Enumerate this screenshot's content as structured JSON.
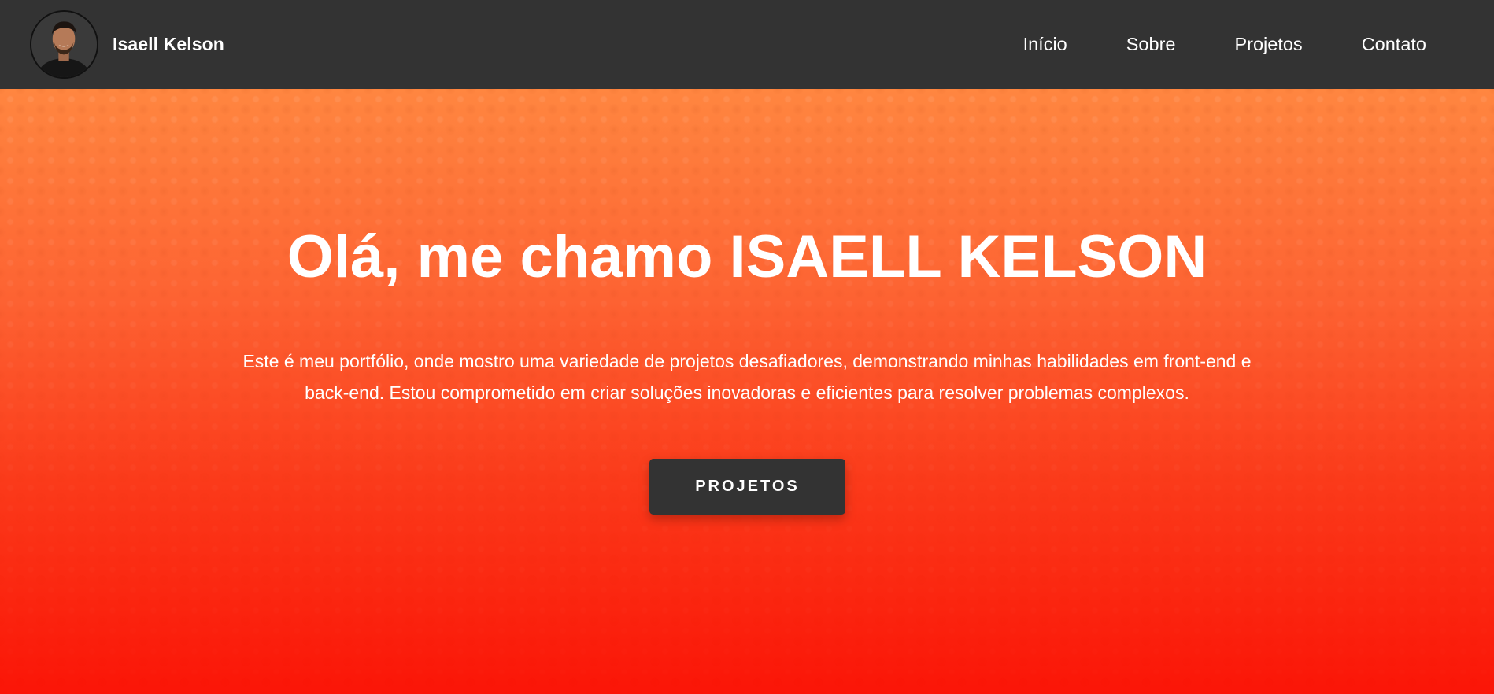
{
  "header": {
    "brand_name": "Isaell Kelson",
    "nav_items": [
      {
        "label": "Início"
      },
      {
        "label": "Sobre"
      },
      {
        "label": "Projetos"
      },
      {
        "label": "Contato"
      }
    ]
  },
  "hero": {
    "title": "Olá, me chamo ISAELL KELSON",
    "description": "Este é meu portfólio, onde mostro uma variedade de projetos desafiadores, demonstrando minhas habilidades em front-end e back-end. Estou comprometido em criar soluções inovadoras e eficientes para resolver problemas complexos.",
    "button_label": "PROJETOS"
  },
  "colors": {
    "navbar_bg": "#333333",
    "hero_gradient_top": "#ff8640",
    "hero_gradient_bottom": "#fb1507",
    "button_bg": "#333333",
    "text": "#ffffff"
  }
}
